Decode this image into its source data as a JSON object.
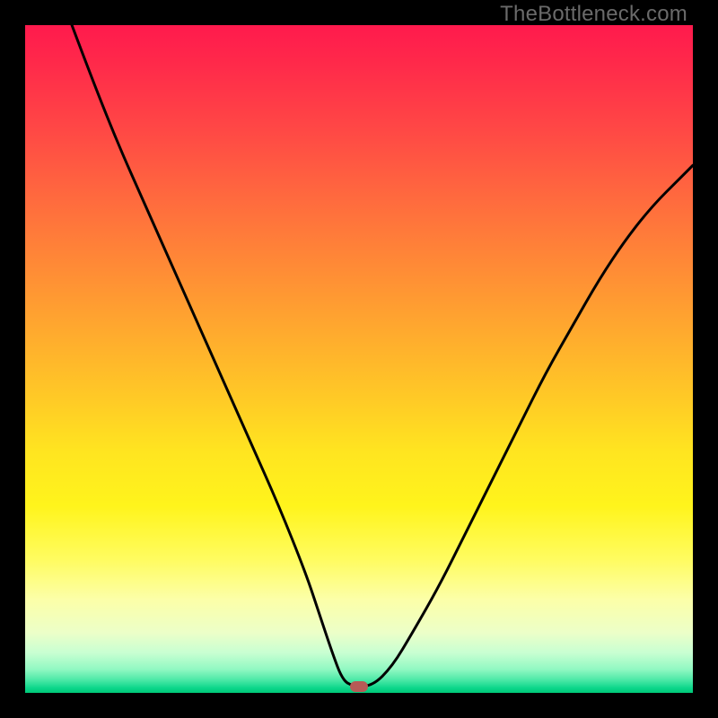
{
  "watermark": "TheBottleneck.com",
  "colors": {
    "page_background": "#000000",
    "curve_stroke": "#000000",
    "marker_fill": "#b75a56",
    "watermark_text": "#6a6a6a"
  },
  "chart_data": {
    "type": "line",
    "title": "",
    "xlabel": "",
    "ylabel": "",
    "xlim": [
      0,
      100
    ],
    "ylim": [
      0,
      100
    ],
    "grid": false,
    "legend": false,
    "series": [
      {
        "name": "bottleneck-curve",
        "x": [
          7,
          10,
          14,
          18,
          22,
          26,
          30,
          34,
          38,
          42,
          44,
          46,
          47.5,
          49,
          52,
          55,
          58,
          62,
          66,
          70,
          74,
          78,
          82,
          86,
          90,
          94,
          98,
          100
        ],
        "values": [
          100,
          92,
          82,
          73,
          64,
          55,
          46,
          37,
          28,
          18,
          12,
          6,
          2,
          1,
          1,
          4,
          9,
          16,
          24,
          32,
          40,
          48,
          55,
          62,
          68,
          73,
          77,
          79
        ]
      }
    ],
    "annotations": [
      {
        "name": "minimum-marker",
        "x": 50,
        "y": 1
      }
    ],
    "background_gradient": {
      "direction": "vertical",
      "stops": [
        {
          "pos": 0.0,
          "color": "#ff1a4d"
        },
        {
          "pos": 0.5,
          "color": "#ffca26"
        },
        {
          "pos": 0.8,
          "color": "#fffc60"
        },
        {
          "pos": 0.94,
          "color": "#c8ffd2"
        },
        {
          "pos": 1.0,
          "color": "#00c777"
        }
      ]
    }
  }
}
